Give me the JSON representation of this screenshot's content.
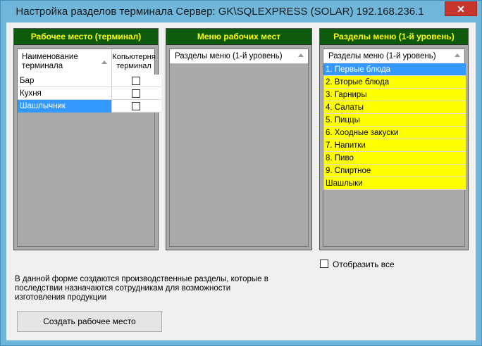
{
  "window": {
    "title": "Настройка разделов терминала  Сервер: GK\\SQLEXPRESS (SOLAR) 192.168.236.1",
    "close_label": "✕"
  },
  "panels": {
    "workplace": {
      "header": "Рабочее место (терминал)",
      "columns": [
        "Наименование терминала",
        "Копьютерня терминал"
      ],
      "rows": [
        {
          "name": "Бар",
          "computer_terminal": false,
          "selected": false
        },
        {
          "name": "Кухня",
          "computer_terminal": false,
          "selected": false
        },
        {
          "name": "Шашлычник",
          "computer_terminal": false,
          "selected": true
        }
      ]
    },
    "menus": {
      "header": "Меню рабочих мест",
      "column": "Разделы меню (1-й уровень)",
      "rows": []
    },
    "sections": {
      "header": "Разделы меню (1-й уровень)",
      "column": "Разделы меню (1-й уровень)",
      "rows": [
        {
          "label": "1. Первые блюда",
          "selected": true
        },
        {
          "label": "2. Вторые блюда",
          "selected": false
        },
        {
          "label": "3. Гарниры",
          "selected": false
        },
        {
          "label": "4. Салаты",
          "selected": false
        },
        {
          "label": "5. Пиццы",
          "selected": false
        },
        {
          "label": "6. Хоодные закуски",
          "selected": false
        },
        {
          "label": "7. Напитки",
          "selected": false
        },
        {
          "label": "8. Пиво",
          "selected": false
        },
        {
          "label": "9. Спиртное",
          "selected": false
        },
        {
          "label": "Шашлыки",
          "selected": false
        }
      ]
    }
  },
  "show_all": {
    "label": "Отобразить все",
    "checked": false
  },
  "info_text": "В данной форме создаются производственные разделы, которые в последствии назначаются сотрудникам для возможности изготовления продукции",
  "create_button": "Создать рабочее место",
  "colors": {
    "panel_header_bg": "#0e5b0e",
    "panel_header_text": "#ffff00",
    "row_highlight": "#ffff00",
    "selection": "#3399ff",
    "title_bar": "#6fb6da",
    "close_button": "#c7362d"
  }
}
